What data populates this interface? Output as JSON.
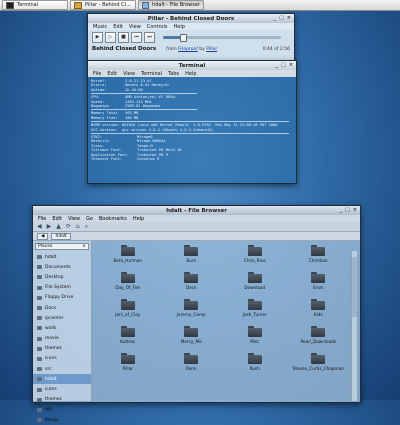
{
  "taskbar": {
    "items": [
      {
        "label": "Terminal",
        "icon": "terminal-icon"
      },
      {
        "label": "Pillar - Behind Cl...",
        "icon": "pillar-icon"
      },
      {
        "label": "hdalt - File Browser",
        "icon": "folder-icon"
      }
    ]
  },
  "pillar": {
    "title": "Pillar - Behind Closed Doors",
    "window_buttons": [
      "_",
      "□",
      "×"
    ],
    "menu": [
      "Music",
      "Edit",
      "View",
      "Controls",
      "Help"
    ],
    "controls": [
      "▶",
      "▷",
      "■",
      "⏮",
      "⏭"
    ],
    "progress": 0.17,
    "track_title": "Behind Closed Doors",
    "from_label": "from",
    "album": "Fireproof",
    "by_label": "by",
    "artist": "Pillar",
    "time": "0:44 of 2:56"
  },
  "terminal": {
    "title": "Terminal",
    "window_buttons": [
      "_",
      "□",
      "×"
    ],
    "menu": [
      "File",
      "Edit",
      "View",
      "Terminal",
      "Tabs",
      "Help"
    ],
    "block1": [
      {
        "k": "Kernel:",
        "v": "2.6.21-23-k7"
      },
      {
        "k": "Distro:",
        "v": "Ubuntu 8.04 Hardy/er"
      },
      {
        "k": "Uptime:",
        "v": "1h 44:09"
      }
    ],
    "block2": [
      {
        "k": "CPU:",
        "v": "AMD Athlon(tm) XP 1800+"
      },
      {
        "k": "Speed:",
        "v": "1483.114 MHz"
      },
      {
        "k": "Bogomips:",
        "v": "2969.81 Bogomips"
      }
    ],
    "block3": [
      {
        "k": "Memory Total:",
        "v": "503 MB"
      },
      {
        "k": "Memory Free:",
        "v": "186 MB"
      }
    ],
    "gpu_line": "NVRM version: NVIDIA Linux x86 Kernel Module  1.0-9762  Mon May 12 23:06:18 PDT 2008",
    "gcc_line": "GCC version:  gcc version 4.0.3 (Ubuntu 4.0.3-1ubuntu5)",
    "block4": [
      {
        "k": "GTK2:",
        "v": "Mirage6"
      },
      {
        "k": "Metacity:",
        "v": "Mirage-BOOKAL"
      },
      {
        "k": "Icons:",
        "v": "Tango-M"
      },
      {
        "k": "Titlebar Font:",
        "v": "Trebuchet MS Bold 10"
      },
      {
        "k": "Application Font:",
        "v": "Trebuchet MS 9"
      },
      {
        "k": "Terminal Font:",
        "v": "Consolas 9"
      }
    ]
  },
  "files": {
    "title": "hdalt - File Browser",
    "window_buttons": [
      "_",
      "□",
      "×"
    ],
    "menu": [
      "File",
      "Edit",
      "View",
      "Go",
      "Bookmarks",
      "Help"
    ],
    "toolbar": [
      "◀",
      "▶",
      "▲",
      "⟳",
      "⌂",
      "⌕"
    ],
    "crumbs": [
      "◀",
      "hdalt"
    ],
    "panel_label": "Places",
    "sidebar": [
      {
        "label": "hdalt",
        "sel": false
      },
      {
        "label": "Documents",
        "sel": false
      },
      {
        "label": "Desktop",
        "sel": false
      },
      {
        "label": "File System",
        "sel": false
      },
      {
        "label": "Floppy Drive",
        "sel": false
      },
      {
        "label": "Docs",
        "sel": false
      },
      {
        "label": "ipcenter",
        "sel": false
      },
      {
        "label": "walls",
        "sel": false
      },
      {
        "label": "movie",
        "sel": false
      },
      {
        "label": "themes",
        "sel": false
      },
      {
        "label": "icons",
        "sel": false
      },
      {
        "label": "src",
        "sel": false
      },
      {
        "label": "hdalt",
        "sel": true
      },
      {
        "label": "icons",
        "sel": false
      },
      {
        "label": "themes",
        "sel": false
      },
      {
        "label": "wp",
        "sel": false
      },
      {
        "label": "4esgo",
        "sel": false
      }
    ],
    "items": [
      "Beta_Harman",
      "Burn",
      "Chris_Rice",
      "Christian",
      "Day_Of_Fire",
      "Deck",
      "Download",
      "Envs",
      "Jars_of_Clay",
      "Jeremy_Camp",
      "Josh_Turner",
      "Kids",
      "Kutless",
      "Mercy_Me",
      "Misc",
      "Pearl_Downloads",
      "Pillar",
      "Remi",
      "Rush",
      "Steven_Curtis_Chapman"
    ]
  }
}
